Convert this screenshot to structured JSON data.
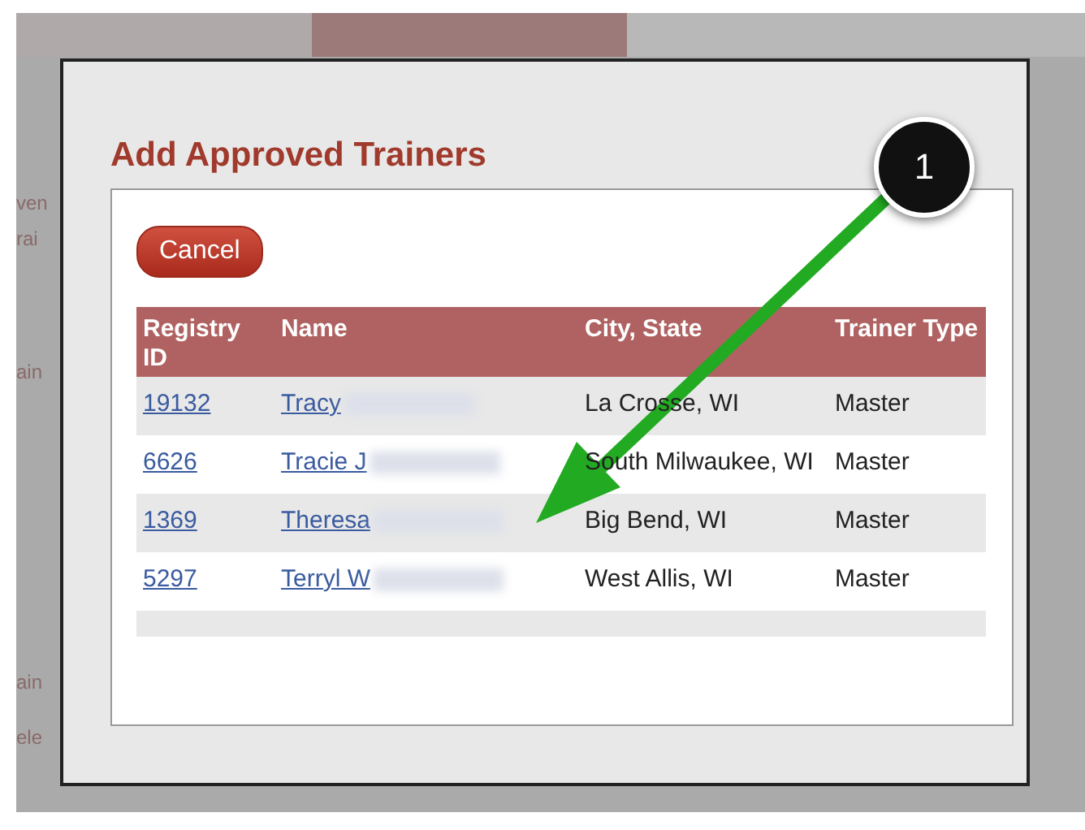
{
  "background": {
    "tabs": [
      {
        "selected": false
      },
      {
        "selected": true
      },
      {
        "selected": false
      }
    ],
    "fragments": [
      "ven",
      "rai",
      "ain",
      "ain",
      "ele"
    ]
  },
  "dialog": {
    "title": "Add Approved Trainers",
    "cancel_button": "Cancel",
    "table": {
      "columns": [
        "Registry ID",
        "Name",
        "City, State",
        "Trainer Type"
      ],
      "rows": [
        {
          "id": "19132",
          "name": "Tracy",
          "city": "La Crosse, WI",
          "type": "Master"
        },
        {
          "id": "6626",
          "name": "Tracie J",
          "city": "South Milwaukee, WI",
          "type": "Master"
        },
        {
          "id": "1369",
          "name": "Theresa",
          "city": "Big Bend, WI",
          "type": "Master"
        },
        {
          "id": "5297",
          "name": "Terryl W",
          "city": "West Allis, WI",
          "type": "Master"
        }
      ]
    }
  },
  "annotation": {
    "badge": "1"
  }
}
